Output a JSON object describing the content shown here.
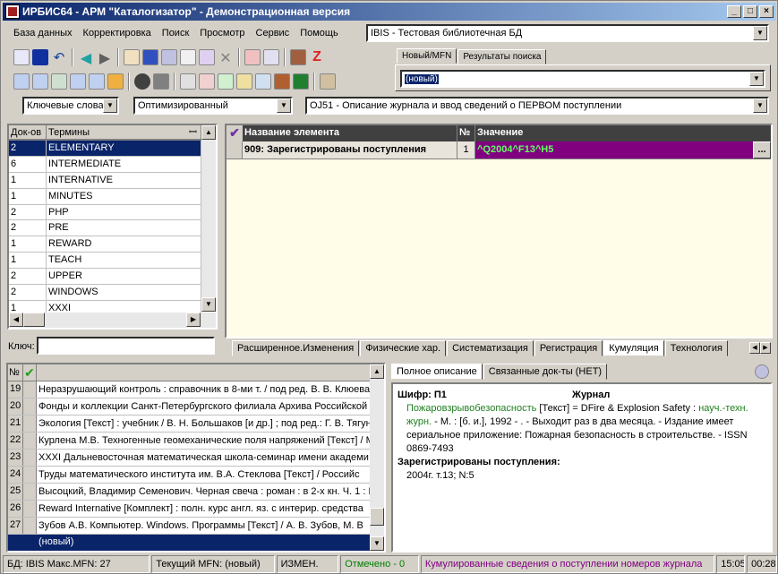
{
  "window": {
    "title": "ИРБИС64 - АРМ \"Каталогизатор\" - Демонстрационная версия",
    "min": "_",
    "max": "□",
    "close": "×"
  },
  "menu": [
    "База данных",
    "Корректировка",
    "Поиск",
    "Просмотр",
    "Сервис",
    "Помощь"
  ],
  "db_combo": "IBIS - Тестовая библиотечная БД",
  "right_tabs": [
    "Новый/MFN",
    "Результаты поиска"
  ],
  "new_combo": "(новый)",
  "filter": {
    "keywords": "Ключевые слова",
    "mode": "Оптимизированный",
    "worksheet": "OJ51 - Описание журнала и ввод сведений о ПЕРВОМ поступлении"
  },
  "dictionary": {
    "headers": [
      "Док-ов",
      "Термины"
    ],
    "rows": [
      {
        "count": "2",
        "term": "ELEMENTARY"
      },
      {
        "count": "6",
        "term": "INTERMEDIATE"
      },
      {
        "count": "1",
        "term": "INTERNATIVE"
      },
      {
        "count": "1",
        "term": "MINUTES"
      },
      {
        "count": "2",
        "term": "PHP"
      },
      {
        "count": "2",
        "term": "PRE"
      },
      {
        "count": "1",
        "term": "REWARD"
      },
      {
        "count": "1",
        "term": "TEACH"
      },
      {
        "count": "2",
        "term": "UPPER"
      },
      {
        "count": "2",
        "term": "WINDOWS"
      },
      {
        "count": "1",
        "term": "XXXI"
      }
    ],
    "key_label": "Ключ:"
  },
  "editor": {
    "headers": [
      "Название элемента",
      "№",
      "Значение"
    ],
    "row": {
      "name": "909: Зарегистрированы поступления",
      "num": "1",
      "value": "^Q2004^F13^H5"
    },
    "ellipsis": "...",
    "tabs": [
      "Расширенное.Изменения",
      "Физические хар.",
      "Систематизация",
      "Регистрация",
      "Кумуляция",
      "Технология"
    ]
  },
  "records": {
    "header_num": "№",
    "rows": [
      {
        "n": "19",
        "t": "Неразрушающий контроль : справочник в 8-ми т. / под ред. В. В. Клюева"
      },
      {
        "n": "20",
        "t": "Фонды и коллекции Санкт-Петербургского филиала Архива Российской"
      },
      {
        "n": "21",
        "t": "Экология [Текст] : учебник / В. Н. Большаков [и др.] ; под ред.: Г. В. Тягун"
      },
      {
        "n": "22",
        "t": "Курлена М.В. Техногенные геомеханические поля напряжений [Текст] / М"
      },
      {
        "n": "23",
        "t": "XXXI Дальневосточная математическая школа-семинар имени академи"
      },
      {
        "n": "24",
        "t": "Труды математического института им. В.А. Стеклова [Текст] / Российс"
      },
      {
        "n": "25",
        "t": "Высоцкий, Владимир Семенович. Черная свеча : роман : в 2-х кн. Ч. 1 : П"
      },
      {
        "n": "26",
        "t": "Reward Internative [Комплект] : полн. курс англ. яз. с интерир. средства"
      },
      {
        "n": "27",
        "t": "Зубов А.В. Компьютер. Windows. Программы [Текст] / А. В. Зубов, М. В"
      }
    ],
    "new_row": "(новый)"
  },
  "description": {
    "tabs": [
      "Полное описание",
      "Связанные док-ты (НЕТ)"
    ],
    "shifr": "Шифр: П1",
    "kind": "Журнал",
    "title_link": "Пожаровзрывобезопасность",
    "text1": " [Текст] = DFire & Explosion Safety : ",
    "link2": "науч.-техн. журн.",
    "text2": " - М. : [б. и.], 1992 -      . - Выходит раз в два месяца. - Издание имеет сериальное приложение: Пожарная безопасность в строительстве. - ISSN 0869-7493",
    "reg_head": "Зарегистрированы поступления:",
    "reg_text": "2004г. т.13; N:5"
  },
  "status": {
    "db": "БД: IBIS Макс.MFN: 27",
    "mfn": "Текущий MFN: (новый)",
    "changed": "ИЗМЕН.",
    "marked": "Отмечено - 0",
    "info": "Кумулированные сведения о поступлении номеров журнала",
    "time": "15:05",
    "elapsed": "00:28"
  },
  "colors": {
    "accent": "#0a246a",
    "value_bg": "#800080",
    "editor_bg": "#fffde8",
    "link": "#208020",
    "marked": "#008000",
    "info": "#800080"
  }
}
